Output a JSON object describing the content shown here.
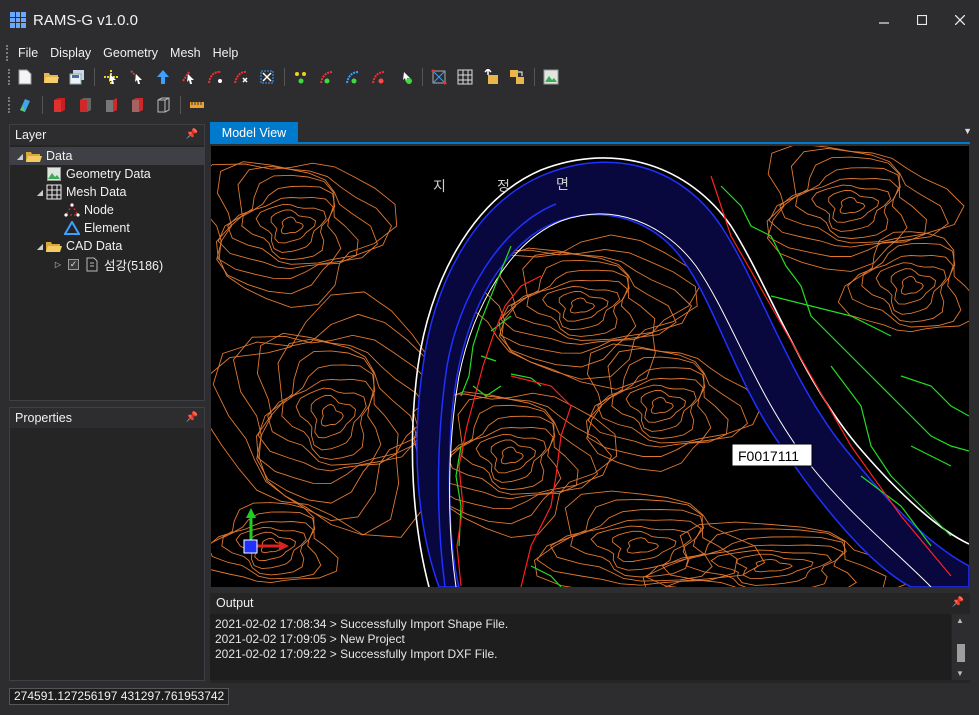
{
  "window": {
    "title": "RAMS-G v1.0.0"
  },
  "menu": [
    "File",
    "Display",
    "Geometry",
    "Mesh",
    "Help"
  ],
  "toolbar_row1": [
    "new-file-icon",
    "open-folder-icon",
    "save-icon",
    "select-node-icon",
    "move-node-icon",
    "add-point-icon",
    "select-line-icon",
    "edit-line-icon",
    "split-line-icon",
    "delete-line-icon",
    "node-add-icon",
    "line-add-icon",
    "curve-add-icon",
    "curve-edit-icon",
    "node-check-icon",
    "mesh-generate-icon",
    "mesh-grid-icon",
    "import-icon",
    "export-icon",
    "image-icon"
  ],
  "toolbar_row2": [
    "layer-color-icon",
    "box-red-icon",
    "box-front-icon",
    "box-side-icon",
    "box-back-icon",
    "box-outline-icon",
    "ruler-icon"
  ],
  "layer_panel": {
    "title": "Layer",
    "tree": {
      "root": "Data",
      "geometry": "Geometry Data",
      "mesh": "Mesh Data",
      "node": "Node",
      "element": "Element",
      "cad": "CAD Data",
      "cad_layer": "섬강(5186)"
    }
  },
  "properties_panel": {
    "title": "Properties"
  },
  "doc_tab": {
    "label": "Model View"
  },
  "model_view": {
    "label_box": "F0017111",
    "map_text": [
      "지",
      "정",
      "면"
    ],
    "colors": {
      "background": "#000000",
      "contour": "#e07830",
      "river": "#0a0a55",
      "river_edge": "#2030ff",
      "road": "#ffffff",
      "parcel": "#22dd22",
      "red_line": "#ff2020"
    }
  },
  "output_panel": {
    "title": "Output",
    "lines": [
      "2021-02-02 17:08:34 > Successfully Import Shape File.",
      "2021-02-02 17:09:05 > New Project",
      "2021-02-02 17:09:22 > Successfully Import DXF File."
    ]
  },
  "status": {
    "coordinates": "274591.127256197 431297.761953742"
  },
  "theme": {
    "accent": "#007acc",
    "panel": "#252526",
    "frame": "#2d2d30"
  }
}
